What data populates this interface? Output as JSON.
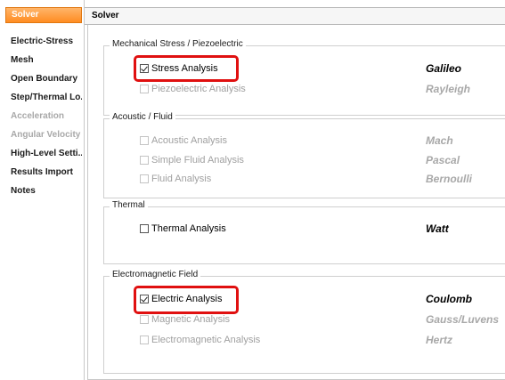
{
  "sidebar": {
    "items": [
      {
        "label": "Solver",
        "state": "active"
      },
      {
        "label": "Electric-Stress",
        "state": "normal"
      },
      {
        "label": "Mesh",
        "state": "normal"
      },
      {
        "label": "Open Boundary",
        "state": "normal"
      },
      {
        "label": "Step/Thermal Lo...",
        "state": "normal"
      },
      {
        "label": "Acceleration",
        "state": "disabled"
      },
      {
        "label": "Angular Velocity",
        "state": "disabled"
      },
      {
        "label": "High-Level Setti...",
        "state": "normal"
      },
      {
        "label": "Results Import",
        "state": "normal"
      },
      {
        "label": "Notes",
        "state": "normal"
      }
    ]
  },
  "header": {
    "title": "Solver"
  },
  "groups": {
    "mechanical": {
      "title": "Mechanical Stress / Piezoelectric",
      "rows": [
        {
          "label": "Stress Analysis",
          "solver": "Galileo",
          "checked": true,
          "enabled": true
        },
        {
          "label": "Piezoelectric Analysis",
          "solver": "Rayleigh",
          "checked": false,
          "enabled": false
        }
      ]
    },
    "acoustic": {
      "title": "Acoustic / Fluid",
      "rows": [
        {
          "label": "Acoustic Analysis",
          "solver": "Mach",
          "checked": false,
          "enabled": false
        },
        {
          "label": "Simple Fluid Analysis",
          "solver": "Pascal",
          "checked": false,
          "enabled": false
        },
        {
          "label": "Fluid Analysis",
          "solver": "Bernoulli",
          "checked": false,
          "enabled": false
        }
      ]
    },
    "thermal": {
      "title": "Thermal",
      "rows": [
        {
          "label": "Thermal Analysis",
          "solver": "Watt",
          "checked": false,
          "enabled": true
        }
      ]
    },
    "electromagnetic": {
      "title": "Electromagnetic Field",
      "rows": [
        {
          "label": "Electric Analysis",
          "solver": "Coulomb",
          "checked": true,
          "enabled": true
        },
        {
          "label": "Magnetic Analysis",
          "solver": "Gauss/Luvens",
          "checked": false,
          "enabled": false
        },
        {
          "label": "Electromagnetic Analysis",
          "solver": "Hertz",
          "checked": false,
          "enabled": false
        }
      ]
    }
  },
  "colors": {
    "accent": "#ff8c22",
    "highlight": "#e01010",
    "disabled_text": "#a0a0a0"
  }
}
